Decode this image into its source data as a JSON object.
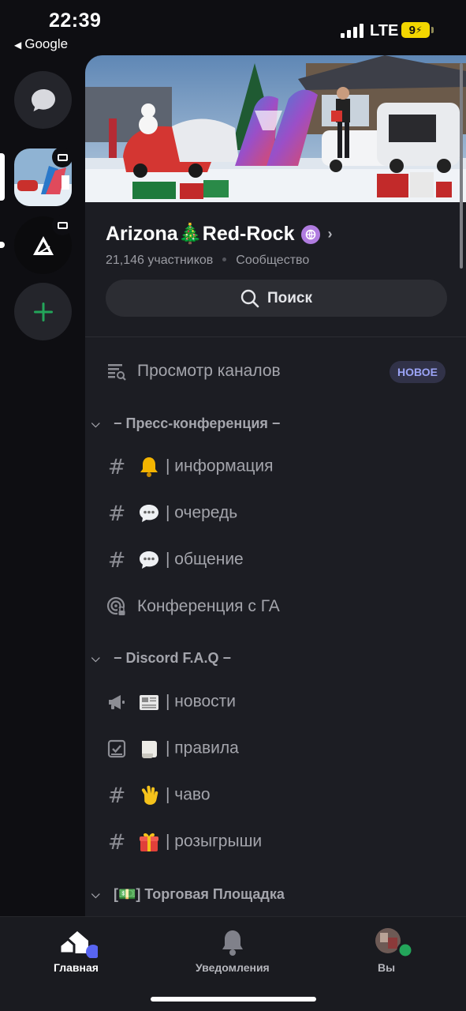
{
  "status_bar": {
    "time": "22:39",
    "back_app": "Google",
    "network": "LTE",
    "battery": "9"
  },
  "server": {
    "name": "Arizona🎄Red-Rock",
    "members": "21,146 участников",
    "type": "Сообщество",
    "search_label": "Поиск"
  },
  "browse": {
    "label": "Просмотр каналов",
    "badge": "НОВОЕ"
  },
  "categories": [
    {
      "title": "− Пресс-конференция −",
      "channels": [
        {
          "icon": "hash-icon",
          "name": "| информация"
        },
        {
          "icon": "hash-icon",
          "name": "| очередь"
        },
        {
          "icon": "hash-icon",
          "name": "| общение"
        },
        {
          "icon": "stage-icon",
          "name": "Конференция с ГА"
        }
      ]
    },
    {
      "title": "− Discord F.A.Q −",
      "channels": [
        {
          "icon": "megaphone-icon",
          "name": "| новости"
        },
        {
          "icon": "rules-icon",
          "name": "| правила"
        },
        {
          "icon": "hash-icon",
          "name": "| чаво"
        },
        {
          "icon": "hash-icon",
          "name": "| розыгрыши"
        }
      ]
    },
    {
      "title": "[💵] Торговая Площадка",
      "channels": []
    }
  ],
  "tabs": [
    {
      "label": "Главная"
    },
    {
      "label": "Уведомления"
    },
    {
      "label": "Вы"
    }
  ],
  "colors": {
    "background": "#0e0e12",
    "panel": "#1c1d23",
    "accent": "#5865f2",
    "online": "#23a55a"
  }
}
